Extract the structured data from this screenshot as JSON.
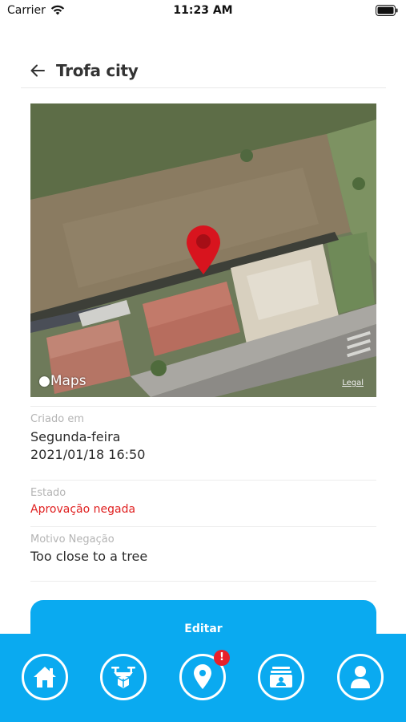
{
  "status_bar": {
    "carrier": "Carrier",
    "time": "11:23 AM"
  },
  "header": {
    "title": "Trofa city"
  },
  "map": {
    "logo_text": "Maps",
    "legal_text": "Legal",
    "pin_color": "#d8141e"
  },
  "details": {
    "created_label": "Criado em",
    "created_day": "Segunda-feira",
    "created_datetime": "2021/01/18  16:50",
    "state_label": "Estado",
    "state_value": "Aprovação negada",
    "reason_label": "Motivo Negação",
    "reason_value": "Too close to a tree"
  },
  "actions": {
    "edit_label": "Editar"
  },
  "tab_bar": {
    "items": [
      {
        "icon": "home-icon"
      },
      {
        "icon": "drone-icon"
      },
      {
        "icon": "location-pin-icon",
        "badge": "!"
      },
      {
        "icon": "id-card-icon"
      },
      {
        "icon": "user-icon"
      }
    ]
  },
  "colors": {
    "accent": "#0aaaf0",
    "error": "#e02020",
    "badge": "#e8202a"
  }
}
